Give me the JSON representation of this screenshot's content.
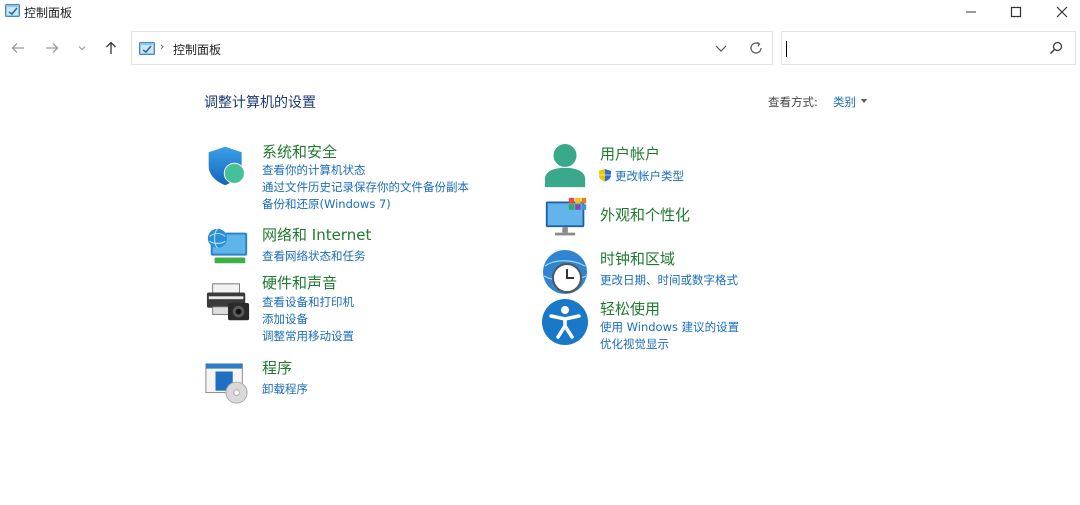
{
  "window": {
    "title": "控制面板"
  },
  "address": {
    "separator": "›",
    "location": "控制面板"
  },
  "search": {
    "placeholder": ""
  },
  "heading": {
    "title": "调整计算机的设置",
    "view_label": "查看方式:",
    "view_value": "类别"
  },
  "categories": {
    "system": {
      "title": "系统和安全",
      "links": [
        "查看你的计算机状态",
        "通过文件历史记录保存你的文件备份副本",
        "备份和还原(Windows 7)"
      ]
    },
    "network": {
      "title": "网络和 Internet",
      "links": [
        "查看网络状态和任务"
      ]
    },
    "hardware": {
      "title": "硬件和声音",
      "links": [
        "查看设备和打印机",
        "添加设备",
        "调整常用移动设置"
      ]
    },
    "programs": {
      "title": "程序",
      "links": [
        "卸载程序"
      ]
    },
    "accounts": {
      "title": "用户帐户",
      "links": [
        "更改帐户类型"
      ]
    },
    "appearance": {
      "title": "外观和个性化",
      "links": []
    },
    "clock": {
      "title": "时钟和区域",
      "links": [
        "更改日期、时间或数字格式"
      ]
    },
    "ease": {
      "title": "轻松使用",
      "links": [
        "使用 Windows 建议的设置",
        "优化视觉显示"
      ]
    }
  },
  "colors": {
    "category_title": "#1f7a2f",
    "link": "#1a6dbd",
    "heading": "#1e3a6e"
  }
}
